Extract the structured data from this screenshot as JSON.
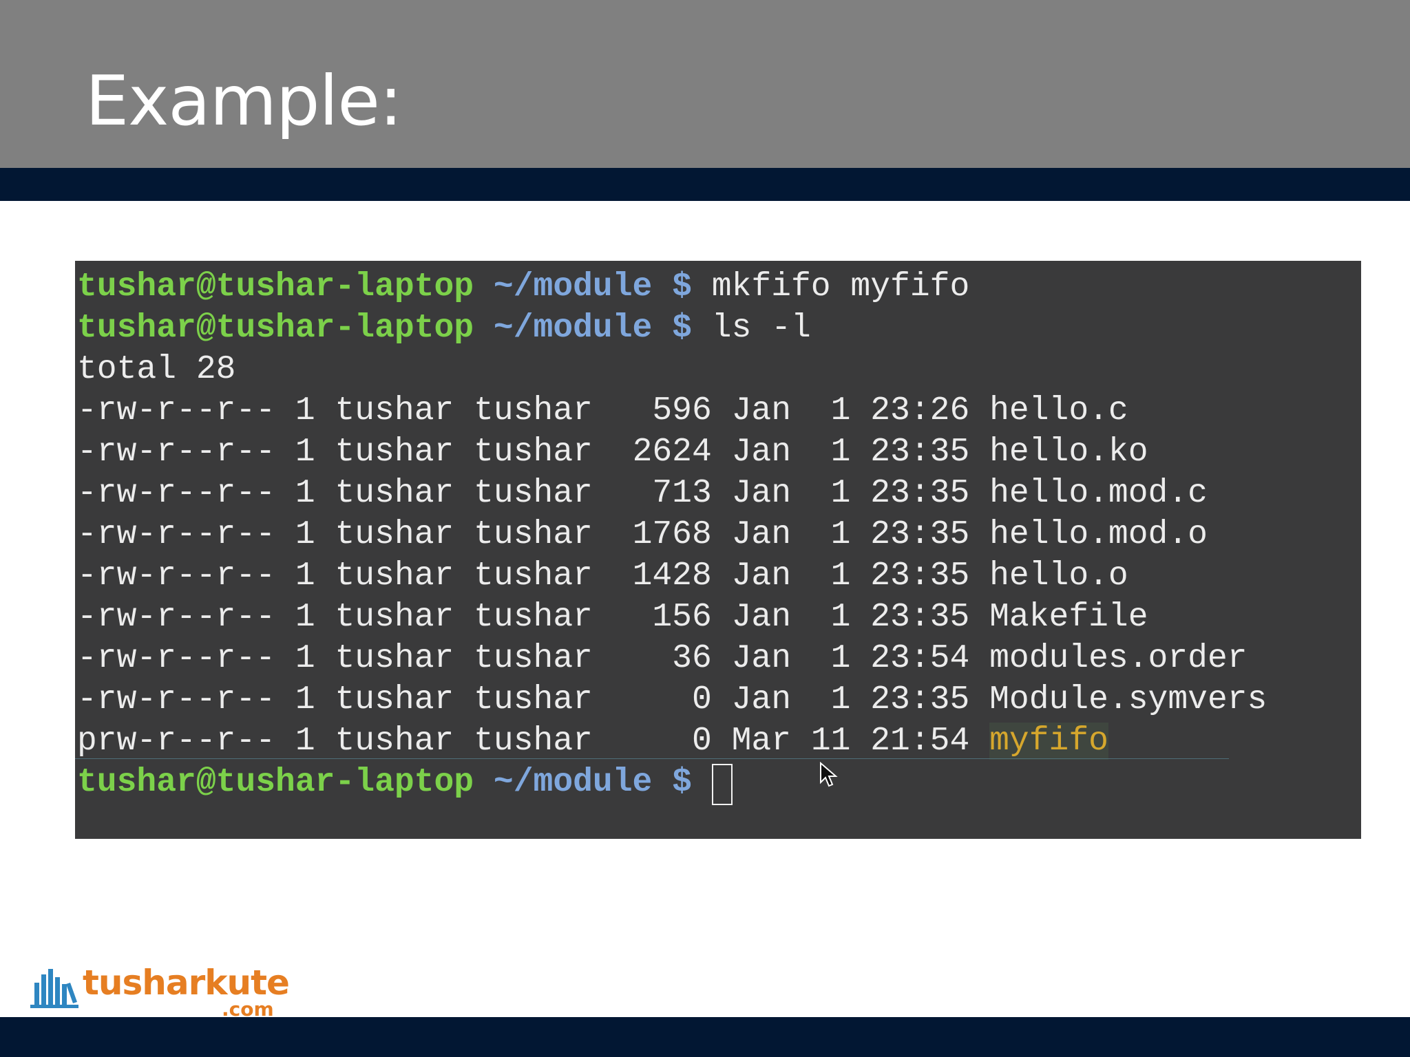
{
  "slide": {
    "title": "Example:"
  },
  "terminal": {
    "prompt": {
      "user": "tushar@tushar-laptop",
      "path": "~/module",
      "symbol": "$"
    },
    "commands": [
      "mkfifo myfifo",
      "ls -l"
    ],
    "total_line": "total 28",
    "listing": [
      {
        "perms": "-rw-r--r--",
        "links": "1",
        "owner": "tushar",
        "group": "tushar",
        "size": "596",
        "month": "Jan",
        "day": "1",
        "time": "23:26",
        "name": "hello.c"
      },
      {
        "perms": "-rw-r--r--",
        "links": "1",
        "owner": "tushar",
        "group": "tushar",
        "size": "2624",
        "month": "Jan",
        "day": "1",
        "time": "23:35",
        "name": "hello.ko"
      },
      {
        "perms": "-rw-r--r--",
        "links": "1",
        "owner": "tushar",
        "group": "tushar",
        "size": "713",
        "month": "Jan",
        "day": "1",
        "time": "23:35",
        "name": "hello.mod.c"
      },
      {
        "perms": "-rw-r--r--",
        "links": "1",
        "owner": "tushar",
        "group": "tushar",
        "size": "1768",
        "month": "Jan",
        "day": "1",
        "time": "23:35",
        "name": "hello.mod.o"
      },
      {
        "perms": "-rw-r--r--",
        "links": "1",
        "owner": "tushar",
        "group": "tushar",
        "size": "1428",
        "month": "Jan",
        "day": "1",
        "time": "23:35",
        "name": "hello.o"
      },
      {
        "perms": "-rw-r--r--",
        "links": "1",
        "owner": "tushar",
        "group": "tushar",
        "size": "156",
        "month": "Jan",
        "day": "1",
        "time": "23:35",
        "name": "Makefile"
      },
      {
        "perms": "-rw-r--r--",
        "links": "1",
        "owner": "tushar",
        "group": "tushar",
        "size": "36",
        "month": "Jan",
        "day": "1",
        "time": "23:54",
        "name": "modules.order"
      },
      {
        "perms": "-rw-r--r--",
        "links": "1",
        "owner": "tushar",
        "group": "tushar",
        "size": "0",
        "month": "Jan",
        "day": "1",
        "time": "23:35",
        "name": "Module.symvers"
      },
      {
        "perms": "prw-r--r--",
        "links": "1",
        "owner": "tushar",
        "group": "tushar",
        "size": "0",
        "month": "Mar",
        "day": "11",
        "time": "21:54",
        "name": "myfifo",
        "highlight": true
      }
    ]
  },
  "logo": {
    "word": "tusharkute",
    "sub": ".com",
    "icon": "books-icon"
  },
  "colors": {
    "header_bg": "#808080",
    "band": "#021733",
    "terminal_bg": "#3a3a3b",
    "prompt_user": "#7cd14a",
    "prompt_path": "#7fa7dd",
    "fifo_name": "#d6a72d",
    "logo_orange": "#e67e22",
    "logo_blue": "#2e86c1"
  }
}
